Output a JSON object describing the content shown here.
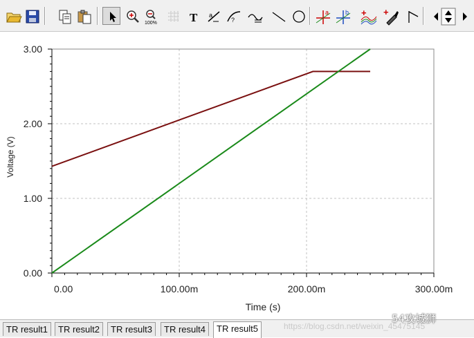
{
  "toolbar": {
    "buttons": [
      {
        "name": "open-folder-icon"
      },
      {
        "name": "save-icon"
      },
      {
        "name": "copy-icon"
      },
      {
        "name": "paste-icon"
      },
      {
        "name": "select-pointer-icon"
      },
      {
        "name": "zoom-in-icon"
      },
      {
        "name": "zoom-100-icon"
      },
      {
        "name": "grid-icon"
      },
      {
        "name": "text-tool-icon"
      },
      {
        "name": "label-tool-icon"
      },
      {
        "name": "marker-tool-icon"
      },
      {
        "name": "trace-tool-icon"
      },
      {
        "name": "line-tool-icon"
      },
      {
        "name": "circle-tool-icon"
      },
      {
        "name": "cursor-a-icon"
      },
      {
        "name": "cursor-b-icon"
      },
      {
        "name": "add-curve-icon"
      },
      {
        "name": "probe-icon"
      },
      {
        "name": "flag-icon"
      },
      {
        "name": "nav-arrows-icon"
      }
    ],
    "zoom_100_text": "100%",
    "cursor_a_text": "a",
    "cursor_b_text": "b"
  },
  "chart_data": {
    "type": "line",
    "xlabel": "Time (s)",
    "ylabel": "Voltage (V)",
    "xlim": [
      0,
      300
    ],
    "ylim": [
      0,
      3
    ],
    "x_ticks": [
      "0.00",
      "100.00m",
      "200.00m",
      "300.00m"
    ],
    "y_ticks": [
      "0.00",
      "1.00",
      "2.00",
      "3.00"
    ],
    "grid": true,
    "series": [
      {
        "color": "#7a1010",
        "points": [
          [
            0,
            1.43
          ],
          [
            100,
            2.05
          ],
          [
            205,
            2.7
          ],
          [
            250,
            2.7
          ]
        ]
      },
      {
        "color": "#1a8a1a",
        "points": [
          [
            0,
            0.0
          ],
          [
            250,
            3.0
          ]
        ]
      }
    ]
  },
  "tabs": [
    {
      "label": "TR result1",
      "active": false
    },
    {
      "label": "TR result2",
      "active": false
    },
    {
      "label": "TR result3",
      "active": false
    },
    {
      "label": "TR result4",
      "active": false
    },
    {
      "label": "TR result5",
      "active": true
    }
  ],
  "watermark": {
    "url": "https://blog.csdn.net/weixin_45475145",
    "brand": "54攻城狮"
  }
}
